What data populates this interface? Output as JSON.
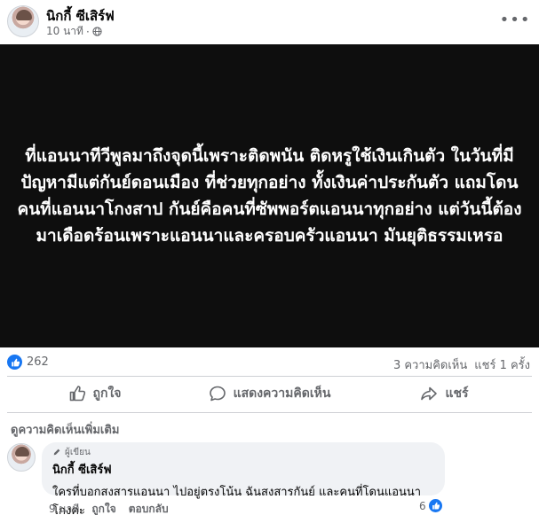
{
  "post": {
    "author": "นิกกี้ ซีเสิร์ฟ",
    "time": "10 นาที",
    "separator": "·",
    "image_text": "ที่แอนนาทีวีพูลมาถึงจุดนี้เพราะติดพนัน ติดหรูใช้เงินเกินตัว ในวันที่มีปัญหามีแต่กันย์ดอนเมือง ที่ช่วยทุกอย่าง ทั้งเงินค่าประกันตัว แถมโดนคนที่แอนนาโกงสาป กันย์คือคนที่ซัพพอร์ตแอนนาทุกอย่าง แต่วันนี้ต้องมาเดือดร้อนเพราะแอนนาและครอบครัวแอนนา มันยุติธรรมเหรอ"
  },
  "stats": {
    "likes": "262",
    "comments": "3 ความคิดเห็น",
    "shares": "แชร์ 1 ครั้ง"
  },
  "actions": {
    "like": "ถูกใจ",
    "comment": "แสดงความคิดเห็น",
    "share": "แชร์"
  },
  "comments_section": {
    "more_label": "ดูความคิดเห็นเพิ่มเติม",
    "comment": {
      "badge": "ผู้เขียน",
      "name": "นิกกี้ ซีเสิร์ฟ",
      "text": "ใครที่บอกสงสารแอนนา ไปอยู่ตรงโน้น ฉันสงสารกันย์ และคนที่โดนแอนนาโกงค่ะ",
      "time": "9 นาที",
      "like": "ถูกใจ",
      "reply": "ตอบกลับ",
      "reactions": "6"
    }
  },
  "colors": {
    "accent": "#1877f2",
    "secondary_text": "#65676b",
    "image_bg": "#0e0e0e"
  },
  "icons": [
    "globe-icon",
    "more-icon",
    "like-icon",
    "comment-icon",
    "share-icon",
    "pencil-icon"
  ]
}
